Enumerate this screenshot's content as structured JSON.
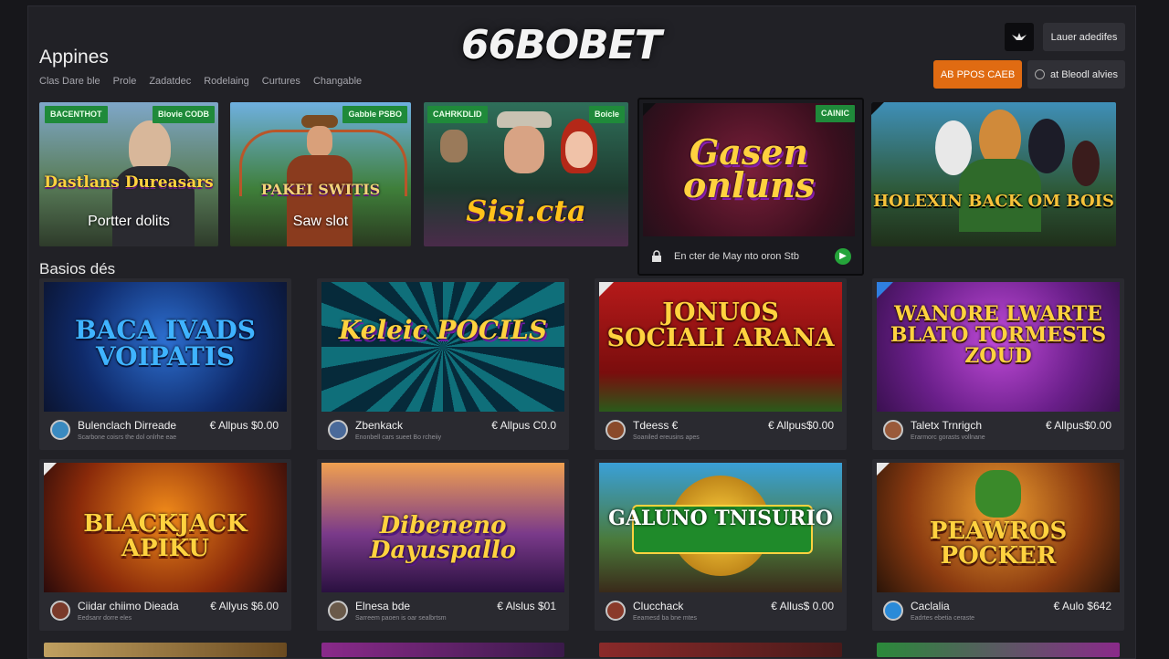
{
  "brand": {
    "logo": "66BOBET"
  },
  "header": {
    "title": "Appines",
    "nav": [
      "Clas Dare ble",
      "Prole",
      "Zadatdec",
      "Rodelaing",
      "Curtures",
      "Changable"
    ],
    "login_label": "Lauer adedifes",
    "promo_label": "AB PPOS CAEB",
    "extra_label": "at Bleodl alvies"
  },
  "featured_row": [
    {
      "tag": "BACENTHOT",
      "tag2": "Blovie CODB",
      "art_title": "Dastlans Dureasars",
      "caption": "Portter dolits"
    },
    {
      "tag": "Gabble PSBO",
      "art_title": "PAKEI SWITIS",
      "caption": "Saw slot"
    },
    {
      "tag": "CAHRKDLID",
      "tag2": "Boicle",
      "art_title": "Sisi.cta"
    },
    {
      "tag": "CAINIC",
      "art_title": "Gasen onluns",
      "bar_text": "En cter de May nto oron Stb",
      "go": "▶"
    },
    {
      "art_title": "HOLEXIN BACK OM BOIS"
    }
  ],
  "section": {
    "title": "Basios dés"
  },
  "cards": [
    {
      "title": "BACA IVADS VOIPATIS",
      "name": "Bulenclach Dirreade",
      "sub": "Scarbone coisrs the dol onlrhe eae",
      "price": "€ Allpus $0.00"
    },
    {
      "title": "Keleic POCILS",
      "name": "Zbenkack",
      "sub": "Enonbell cars sueet Bo rcheiiy",
      "price": "€ Allpus C0.0"
    },
    {
      "title": "JONUOS SOCIALI ARANA",
      "name": "Tdeess €",
      "sub": "Soaniled ereusins apes",
      "price": "€ Allpus$0.00"
    },
    {
      "title": "WANORE LWARTE BLATO TORMESTS ZOUD",
      "name": "Taletx Trnrigch",
      "sub": "Erarmorc gorasts vollnane",
      "price": "€ Allpus$0.00"
    },
    {
      "title": "BLACKJACK APIKU",
      "name": "Ciidar chiimo Dieada",
      "sub": "Eedsanr dorre eles",
      "price": "€ Allyus $6.00"
    },
    {
      "title": "Dibeneno Dayuspallo",
      "name": "Elnesa bde",
      "sub": "Sarreem paoen is oar sealbrtsm",
      "price": "€ Alslus $01"
    },
    {
      "title": "GALUNO TNISURIO",
      "name": "Clucchack",
      "sub": "Eeamesd ba bne mtes",
      "price": "€ Allus$ 0.00"
    },
    {
      "title": "PEAWROS POCKER",
      "name": "Caclalia",
      "sub": "Eadrtes ebetia ceraste",
      "price": "€ Aulo $642"
    }
  ],
  "icons": {
    "logo_badge": "bird-icon",
    "go": "play-icon",
    "lock": "lock-icon",
    "avatar": "avatar-icon"
  },
  "colors": {
    "accent_orange": "#e06b12",
    "tag_green": "#1f8a3a",
    "bg": "#212126"
  }
}
